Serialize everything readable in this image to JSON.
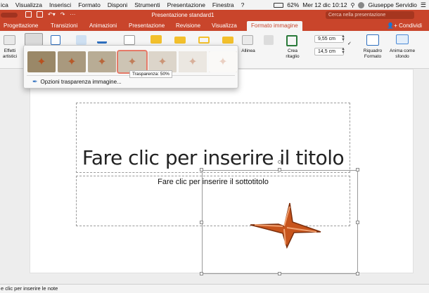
{
  "menubar": {
    "items": [
      "ica",
      "Visualizza",
      "Inserisci",
      "Formato",
      "Disponi",
      "Strumenti",
      "Presentazione",
      "Finestra",
      "?"
    ],
    "battery": "62%",
    "datetime": "Mer 12 dic  10:12",
    "user": "Giuseppe Servidio"
  },
  "titlebar": {
    "title": "Presentazione standard1",
    "search_placeholder": "Cerca nella presentazione"
  },
  "tabs": {
    "items": [
      "Progettazione",
      "Transizioni",
      "Animazioni",
      "Presentazione",
      "Revisione",
      "Visualizza",
      "Formato immagine"
    ],
    "active": "Formato immagine",
    "share": "Condividi"
  },
  "ribbon": {
    "effetti": "Effetti artistici",
    "allinea": "Allinea",
    "crea_ritaglio": "Crea ritaglio",
    "riquadro_formato": "Riquadro Formato",
    "anima_sfondo": "Anima come sfondo",
    "height": "9,55 cm",
    "width": "14,5 cm"
  },
  "gallery": {
    "tooltip": "Trasparenza: 50%",
    "option": "Opzioni trasparenza immagine...",
    "levels": [
      0,
      0.15,
      0.3,
      0.5,
      0.65,
      0.8,
      0.95
    ]
  },
  "slide": {
    "title": "Fare clic per inserire il titolo",
    "subtitle": "Fare clic per inserire il sottotitolo"
  },
  "notes": "e clic per inserire le note"
}
